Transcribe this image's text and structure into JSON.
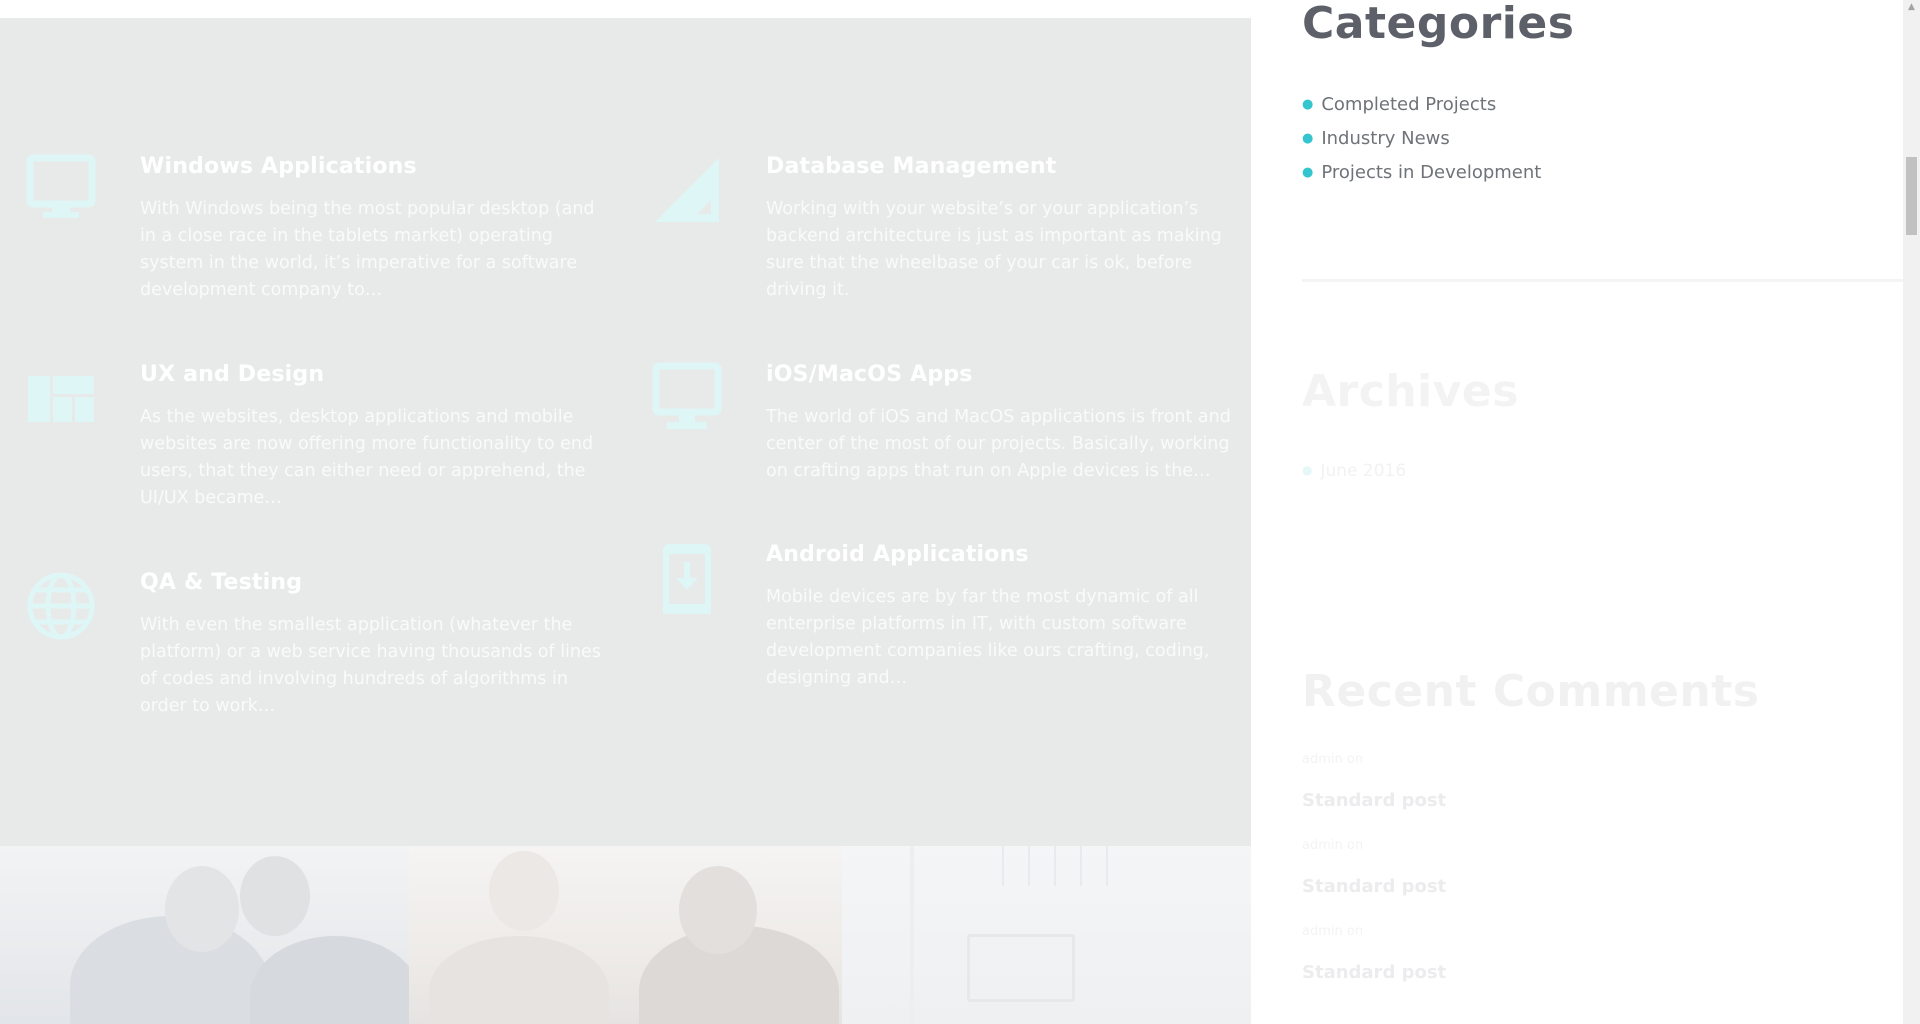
{
  "services": [
    {
      "title": "Windows Applications",
      "text": "With Windows being the most popular desktop (and in a close race in the tablets market) operating system in the world, it’s imperative for a software development company to…",
      "icon": "monitor-icon"
    },
    {
      "title": "Database Management",
      "text": "Working with your website’s or your application’s backend architecture is just as important as making sure that the wheelbase of your car is ok, before driving it.",
      "icon": "signal-bars-icon"
    },
    {
      "title": "UX and Design",
      "text": "As the websites, desktop applications and mobile websites are now offering more functionality to end users, that they can either need or apprehend, the UI/UX became…",
      "icon": "dashboard-icon"
    },
    {
      "title": "iOS/MacOS Apps",
      "text": "The world of iOS and MacOS applications is front and center of the most of our projects. Basically, working on crafting apps that run on Apple devices is the…",
      "icon": "monitor-icon"
    },
    {
      "title": "QA & Testing",
      "text": "With even the smallest application (whatever the platform) or a web service having thousands of lines of codes and involving hundreds of algorithms in order to work…",
      "icon": "globe-icon"
    },
    {
      "title": "Android Applications",
      "text": "Mobile devices are by far the most dynamic of all enterprise platforms in IT, with custom software development companies like ours crafting, coding, designing and…",
      "icon": "mobile-download-icon"
    }
  ],
  "sidebar": {
    "categories": {
      "title": "Categories",
      "items": [
        "Completed Projects",
        "Industry News",
        "Projects in Development"
      ]
    },
    "archives": {
      "title": "Archives",
      "items": [
        "June 2016"
      ]
    },
    "recent_comments": {
      "title": "Recent Comments",
      "items": [
        {
          "meta": "admin on",
          "post": "Standard post"
        },
        {
          "meta": "admin on",
          "post": "Standard post"
        },
        {
          "meta": "admin on",
          "post": "Standard post"
        }
      ]
    }
  },
  "colors": {
    "accent": "#35c5cf",
    "services_bg": "#e8e9e9",
    "heading": "#5d6069"
  }
}
